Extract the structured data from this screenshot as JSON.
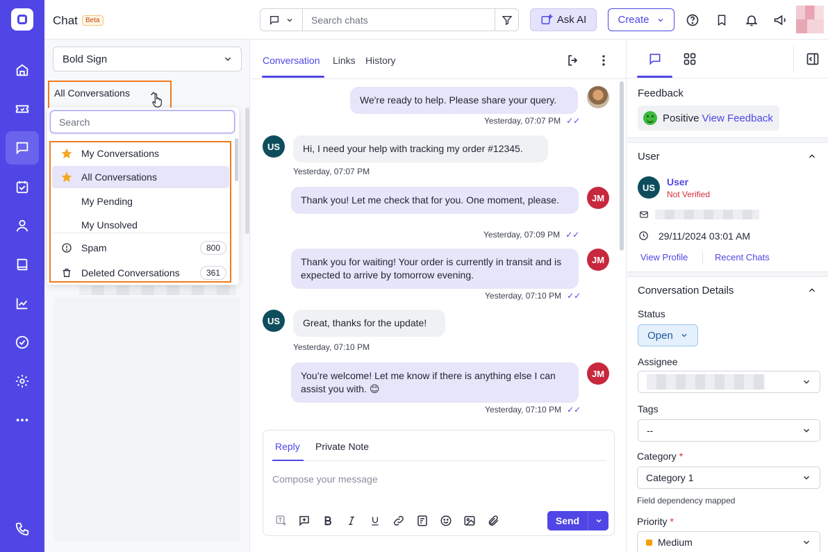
{
  "header": {
    "app_title": "Chat",
    "beta_badge": "Beta",
    "search_placeholder": "Search chats",
    "ask_ai_label": "Ask AI",
    "create_label": "Create"
  },
  "list": {
    "inbox_selected": "Bold Sign",
    "view_selected": "All Conversations"
  },
  "dropdown": {
    "search_placeholder": "Search",
    "items": [
      {
        "label": "My Conversations",
        "icon": "star-icon"
      },
      {
        "label": "All Conversations",
        "icon": "star-icon",
        "selected": true
      },
      {
        "label": "My Pending",
        "icon": ""
      },
      {
        "label": "My Unsolved",
        "icon": ""
      },
      {
        "label": "Spam",
        "icon": "alert-circle-icon",
        "count": "800"
      },
      {
        "label": "Deleted Conversations",
        "icon": "trash-icon",
        "count": "361"
      }
    ]
  },
  "chat": {
    "tabs": [
      "Conversation",
      "Links",
      "History"
    ],
    "messages": [
      {
        "from": "agent",
        "text": "We're ready to help. Please share your query.",
        "time": "Yesterday, 07:07 PM"
      },
      {
        "from": "user",
        "initials": "US",
        "text": "Hi, I need your help with tracking my order #12345.",
        "time": "Yesterday, 07:07 PM"
      },
      {
        "from": "agent",
        "initials": "JM",
        "text": "Thank you! Let me check that for you. One moment, please.",
        "time": "Yesterday, 07:09 PM"
      },
      {
        "from": "agent",
        "initials": "JM",
        "text": "Thank you for waiting! Your order is currently in transit and is expected to arrive by tomorrow evening.",
        "time": "Yesterday, 07:10 PM"
      },
      {
        "from": "user",
        "initials": "US",
        "text": "Great, thanks for the update!",
        "time": "Yesterday, 07:10 PM"
      },
      {
        "from": "agent",
        "initials": "JM",
        "text": "You’re welcome! Let me know if there is anything else I can assist you with. 😊",
        "time": "Yesterday, 07:10 PM"
      }
    ]
  },
  "composer": {
    "tabs": [
      "Reply",
      "Private Note"
    ],
    "placeholder": "Compose your message",
    "send_label": "Send"
  },
  "details": {
    "feedback_title": "Feedback",
    "feedback_value": "Positive",
    "feedback_link": "View Feedback",
    "user_title": "User",
    "user_initials": "US",
    "user_name": "User",
    "user_status": "Not Verified",
    "user_date": "29/11/2024 03:01 AM",
    "view_profile": "View Profile",
    "recent_chats": "Recent Chats",
    "conv_details_title": "Conversation Details",
    "status_label": "Status",
    "status_value": "Open",
    "assignee_label": "Assignee",
    "tags_label": "Tags",
    "tags_value": "--",
    "category_label": "Category",
    "required_mark": "*",
    "category_value": "Category 1",
    "field_dependency_note": "Field dependency mapped",
    "priority_label": "Priority",
    "priority_value": "Medium"
  },
  "colors": {
    "brand": "#4f46e5",
    "rail": "#4f46e5",
    "highlight_box": "#f07a1c",
    "agent_bubble": "#e6e5f9",
    "user_bubble": "#f0f1f4",
    "priority_medium": "#f59e0b"
  }
}
